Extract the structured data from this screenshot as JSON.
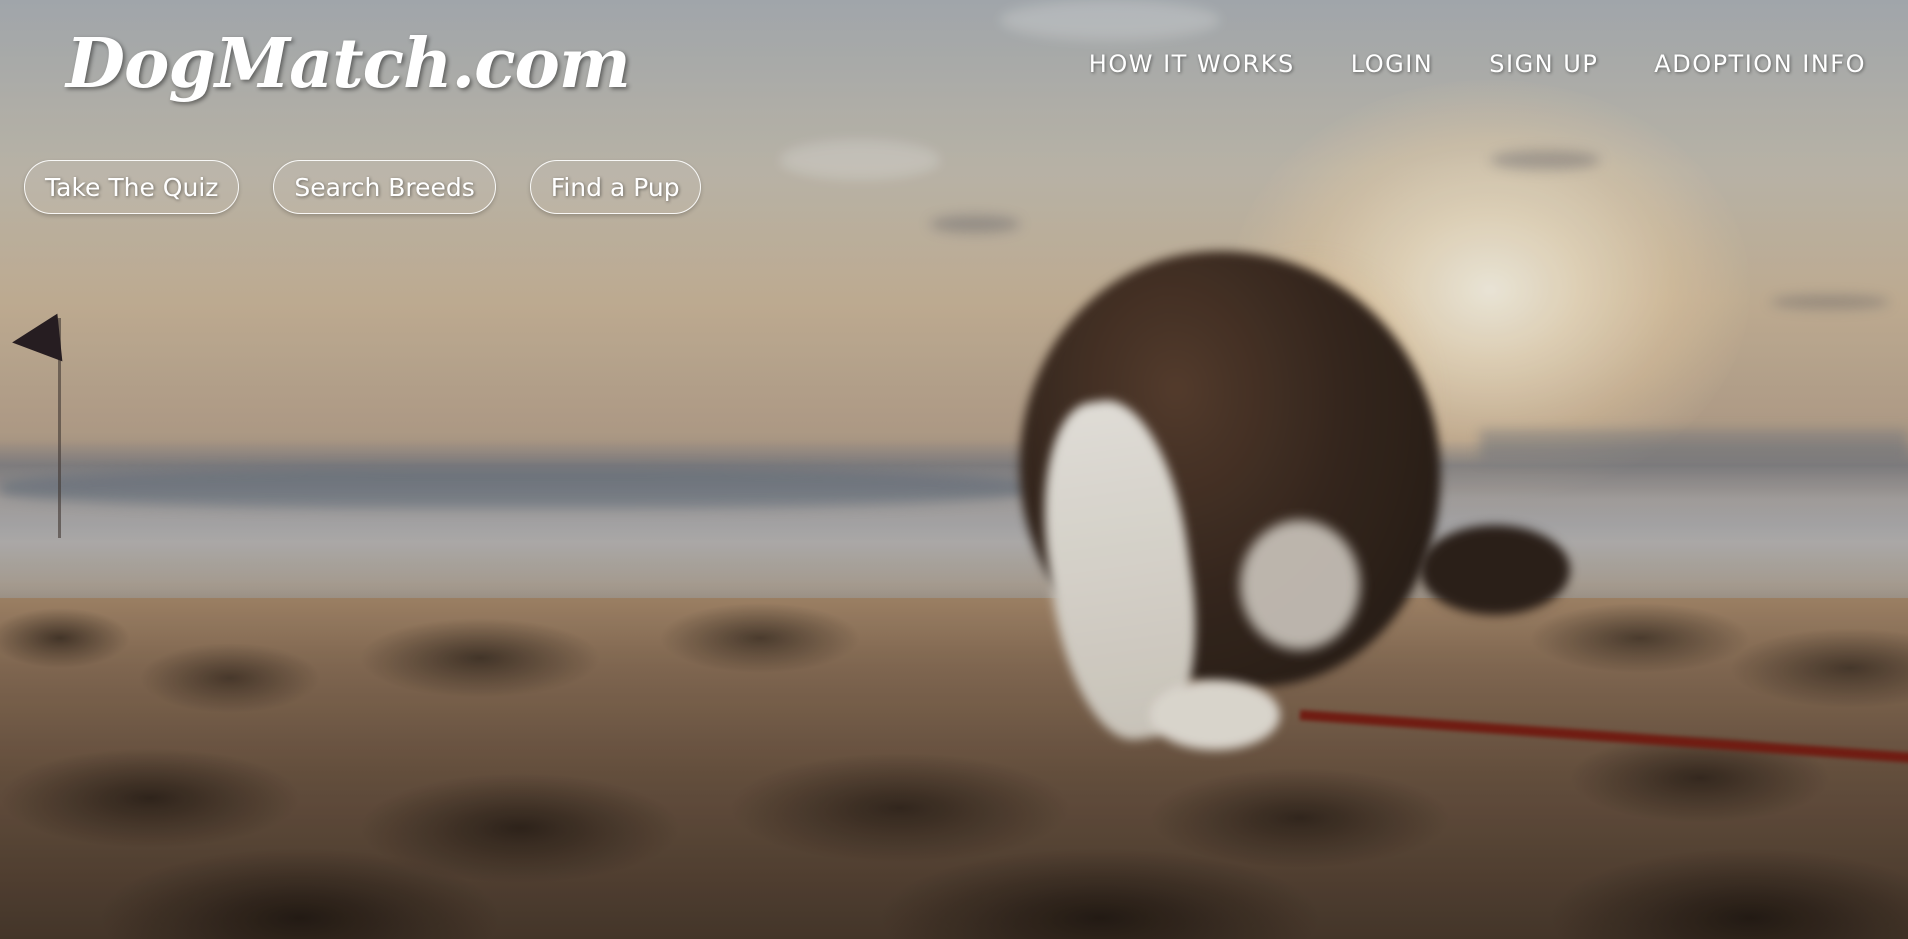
{
  "header": {
    "logo_text": "DogMatch.com",
    "nav": [
      {
        "label": "HOW IT WORKS"
      },
      {
        "label": "LOGIN"
      },
      {
        "label": "SIGN UP"
      },
      {
        "label": "ADOPTION INFO"
      }
    ]
  },
  "actions": [
    {
      "label": "Take The Quiz"
    },
    {
      "label": "Search Breeds"
    },
    {
      "label": "Find a Pup"
    }
  ],
  "colors": {
    "text": "#ffffff",
    "leash": "#7a1f14"
  }
}
